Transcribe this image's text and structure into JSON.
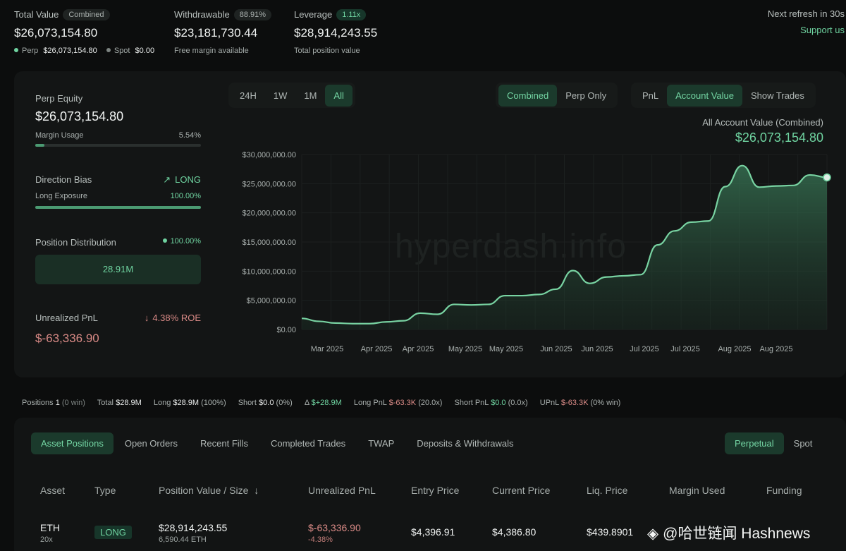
{
  "header": {
    "total_value": {
      "label": "Total Value",
      "badge": "Combined",
      "value": "$26,073,154.80",
      "perp_label": "Perp",
      "perp_value": "$26,073,154.80",
      "spot_label": "Spot",
      "spot_value": "$0.00"
    },
    "withdrawable": {
      "label": "Withdrawable",
      "badge": "88.91%",
      "value": "$23,181,730.44",
      "sub": "Free margin available"
    },
    "leverage": {
      "label": "Leverage",
      "badge": "1.11x",
      "value": "$28,914,243.55",
      "sub": "Total position value"
    },
    "refresh": "Next refresh in 30s",
    "support": "Support us"
  },
  "left_panel": {
    "perp_equity_label": "Perp Equity",
    "perp_equity_value": "$26,073,154.80",
    "margin_usage_label": "Margin Usage",
    "margin_usage_value": "5.54%",
    "margin_usage_fraction": 0.0554,
    "direction_bias_label": "Direction Bias",
    "direction_bias_value": "LONG",
    "long_exposure_label": "Long Exposure",
    "long_exposure_value": "100.00%",
    "long_exposure_fraction": 1.0,
    "position_distribution_label": "Position Distribution",
    "position_distribution_value": "100.00%",
    "distribution_box": "28.91M",
    "unrealized_pnl_label": "Unrealized PnL",
    "roe": "4.38% ROE",
    "unrealized_pnl_value": "$-63,336.90"
  },
  "chart_controls": {
    "ranges": [
      "24H",
      "1W",
      "1M",
      "All"
    ],
    "active_range": "All",
    "modes": [
      "Combined",
      "Perp Only"
    ],
    "active_mode": "Combined",
    "metrics": [
      "PnL",
      "Account Value",
      "Show Trades"
    ],
    "active_metric": "Account Value"
  },
  "chart_data": {
    "type": "area",
    "title": "All Account Value (Combined)",
    "headline_value": "$26,073,154.80",
    "watermark": "hyperdash.info",
    "y_ticks": [
      "$30,000,000.00",
      "$25,000,000.00",
      "$20,000,000.00",
      "$15,000,000.00",
      "$10,000,000.00",
      "$5,000,000.00",
      "$0.00"
    ],
    "ylim": [
      0,
      30000000
    ],
    "x_ticks": [
      "Mar 2025",
      "Apr 2025",
      "Apr 2025",
      "May 2025",
      "May 2025",
      "Jun 2025",
      "Jun 2025",
      "Jul 2025",
      "Jul 2025",
      "Aug 2025",
      "Aug 2025"
    ],
    "series": [
      {
        "values": [
          1900000,
          1400000,
          1100000,
          1000000,
          1000000,
          1300000,
          1500000,
          2800000,
          2600000,
          4300000,
          4200000,
          4300000,
          5800000,
          5800000,
          6000000,
          6900000,
          10100000,
          7900000,
          9000000,
          9200000,
          9400000,
          14500000,
          16900000,
          18400000,
          18600000,
          24500000,
          28100000,
          24400000,
          24600000,
          24700000,
          26500000,
          26073154.8
        ]
      }
    ],
    "line_color": "#78d3a2",
    "fill_color": "#2f5c44"
  },
  "stats_bar": {
    "positions_label": "Positions",
    "positions": "1",
    "positions_win": "(0 win)",
    "total_label": "Total",
    "total": "$28.9M",
    "long_label": "Long",
    "long": "$28.9M",
    "long_pct": "(100%)",
    "short_label": "Short",
    "short": "$0.0",
    "short_pct": "(0%)",
    "delta_label": "Δ",
    "delta": "$+28.9M",
    "long_pnl_label": "Long PnL",
    "long_pnl": "$-63.3K",
    "long_pnl_ratio": "(20.0x)",
    "short_pnl_label": "Short PnL",
    "short_pnl": "$0.0",
    "short_pnl_ratio": "(0.0x)",
    "upnl_label": "UPnL",
    "upnl": "$-63.3K",
    "upnl_win": "(0% win)"
  },
  "bottom_tabs": [
    "Asset Positions",
    "Open Orders",
    "Recent Fills",
    "Completed Trades",
    "TWAP",
    "Deposits & Withdrawals"
  ],
  "active_bottom_tab": "Asset Positions",
  "market_tabs": [
    "Perpetual",
    "Spot"
  ],
  "active_market_tab": "Perpetual",
  "table": {
    "headers": [
      "Asset",
      "Type",
      "Position Value / Size",
      "Unrealized PnL",
      "Entry Price",
      "Current Price",
      "Liq. Price",
      "Margin Used",
      "Funding"
    ],
    "row": {
      "asset": "ETH",
      "leverage": "20x",
      "type": "LONG",
      "position_value": "$28,914,243.55",
      "size": "6,590.44 ETH",
      "pnl": "$-63,336.90",
      "pnl_pct": "-4.38%",
      "entry": "$4,396.91",
      "current": "$4,386.80",
      "liq": "$439.8901"
    }
  },
  "source_watermark": "@哈世链闻 Hashnews"
}
